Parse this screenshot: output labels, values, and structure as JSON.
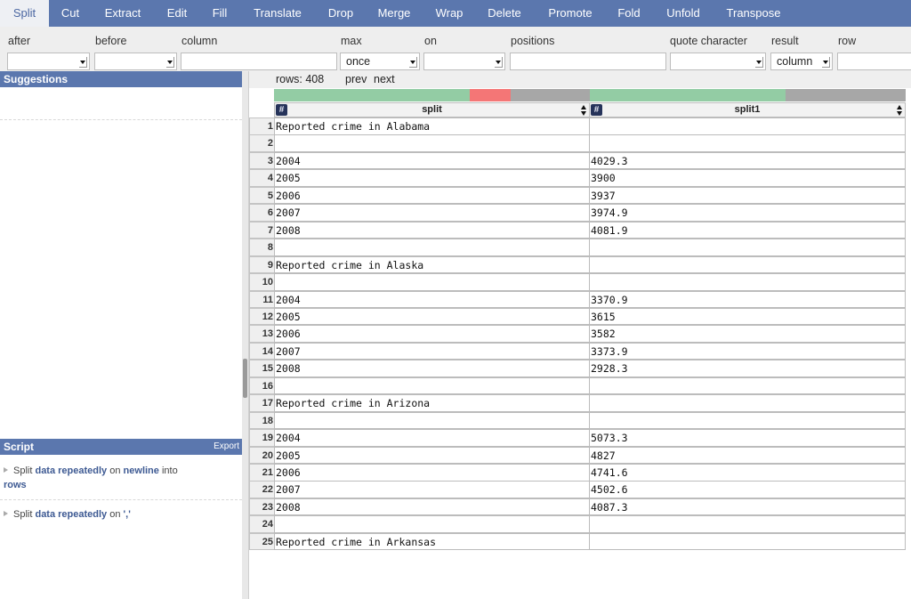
{
  "menu": {
    "tabs": [
      {
        "label": "Split",
        "active": true
      },
      {
        "label": "Cut"
      },
      {
        "label": "Extract"
      },
      {
        "label": "Edit"
      },
      {
        "label": "Fill"
      },
      {
        "label": "Translate"
      },
      {
        "label": "Drop"
      },
      {
        "label": "Merge"
      },
      {
        "label": "Wrap"
      },
      {
        "label": "Delete"
      },
      {
        "label": "Promote"
      },
      {
        "label": "Fold"
      },
      {
        "label": "Unfold"
      },
      {
        "label": "Transpose"
      }
    ]
  },
  "params": {
    "after": {
      "label": "after",
      "value": ""
    },
    "before": {
      "label": "before",
      "value": ""
    },
    "column": {
      "label": "column",
      "value": ""
    },
    "max": {
      "label": "max",
      "value": "once"
    },
    "on": {
      "label": "on",
      "value": ""
    },
    "positions": {
      "label": "positions",
      "value": ""
    },
    "quote_character": {
      "label": "quote character",
      "value": ""
    },
    "result": {
      "label": "result",
      "value": "column"
    },
    "row": {
      "label": "row",
      "value": ""
    }
  },
  "sidebar": {
    "suggestions_title": "Suggestions",
    "script_title": "Script",
    "export_label": "Export",
    "steps": [
      {
        "verb": "Split",
        "target": "data repeatedly",
        "prep": "on",
        "arg": "newline",
        "prep2": "into",
        "arg2": "rows"
      },
      {
        "verb": "Split",
        "target": "data repeatedly",
        "prep": "on",
        "arg": "','"
      }
    ]
  },
  "grid": {
    "rows_label": "rows: 408",
    "prev_label": "prev",
    "next_label": "next",
    "colors": {
      "valid": "#93cca4",
      "error": "#f47676",
      "empty": "#a7a7a7",
      "header": "#5b77ae"
    },
    "columns": [
      {
        "name": "split",
        "type_icon": "#",
        "quality": {
          "valid": 0.62,
          "error": 0.13,
          "empty": 0.25
        }
      },
      {
        "name": "split1",
        "type_icon": "#",
        "quality": {
          "valid": 0.62,
          "error": 0.0,
          "empty": 0.38
        }
      }
    ],
    "rows": [
      {
        "n": "1",
        "c1": "Reported crime in Alabama",
        "c2": ""
      },
      {
        "n": "2",
        "c1": "",
        "c2": ""
      },
      {
        "n": "3",
        "c1": "2004",
        "c2": "4029.3"
      },
      {
        "n": "4",
        "c1": "2005",
        "c2": "3900"
      },
      {
        "n": "5",
        "c1": "2006",
        "c2": "3937"
      },
      {
        "n": "6",
        "c1": "2007",
        "c2": "3974.9"
      },
      {
        "n": "7",
        "c1": "2008",
        "c2": "4081.9"
      },
      {
        "n": "8",
        "c1": "",
        "c2": ""
      },
      {
        "n": "9",
        "c1": "Reported crime in Alaska",
        "c2": ""
      },
      {
        "n": "10",
        "c1": "",
        "c2": ""
      },
      {
        "n": "11",
        "c1": "2004",
        "c2": "3370.9"
      },
      {
        "n": "12",
        "c1": "2005",
        "c2": "3615"
      },
      {
        "n": "13",
        "c1": "2006",
        "c2": "3582"
      },
      {
        "n": "14",
        "c1": "2007",
        "c2": "3373.9"
      },
      {
        "n": "15",
        "c1": "2008",
        "c2": "2928.3"
      },
      {
        "n": "16",
        "c1": "",
        "c2": ""
      },
      {
        "n": "17",
        "c1": "Reported crime in Arizona",
        "c2": ""
      },
      {
        "n": "18",
        "c1": "",
        "c2": ""
      },
      {
        "n": "19",
        "c1": "2004",
        "c2": "5073.3"
      },
      {
        "n": "20",
        "c1": "2005",
        "c2": "4827"
      },
      {
        "n": "21",
        "c1": "2006",
        "c2": "4741.6"
      },
      {
        "n": "22",
        "c1": "2007",
        "c2": "4502.6"
      },
      {
        "n": "23",
        "c1": "2008",
        "c2": "4087.3"
      },
      {
        "n": "24",
        "c1": "",
        "c2": ""
      },
      {
        "n": "25",
        "c1": "Reported crime in Arkansas",
        "c2": ""
      }
    ]
  }
}
